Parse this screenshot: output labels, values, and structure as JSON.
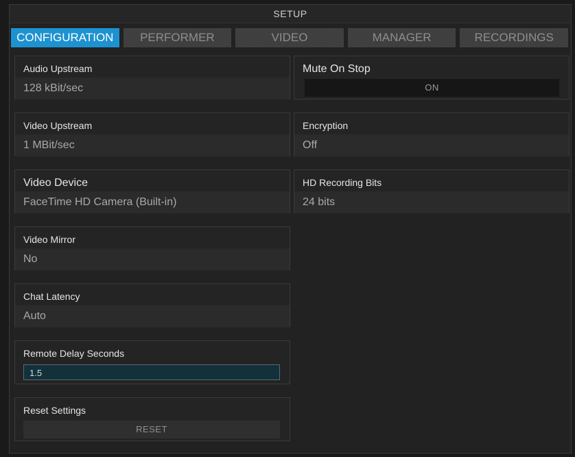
{
  "window": {
    "title": "SETUP"
  },
  "tabs": [
    {
      "label": "CONFIGURATION",
      "active": true
    },
    {
      "label": "PERFORMER",
      "active": false
    },
    {
      "label": "VIDEO",
      "active": false
    },
    {
      "label": "MANAGER",
      "active": false
    },
    {
      "label": "RECORDINGS",
      "active": false
    }
  ],
  "left_settings": {
    "audio_upstream": {
      "label": "Audio Upstream",
      "value": "128 kBit/sec"
    },
    "video_upstream": {
      "label": "Video Upstream",
      "value": "1 MBit/sec"
    },
    "video_device": {
      "label": "Video Device",
      "value": "FaceTime HD Camera (Built-in)"
    },
    "video_mirror": {
      "label": "Video Mirror",
      "value": "No"
    },
    "chat_latency": {
      "label": "Chat Latency",
      "value": "Auto"
    },
    "remote_delay": {
      "label": "Remote Delay Seconds",
      "value": "1.5"
    },
    "reset_settings": {
      "label": "Reset Settings",
      "button": "RESET"
    }
  },
  "right_settings": {
    "mute_on_stop": {
      "label": "Mute On Stop",
      "button": "ON"
    },
    "encryption": {
      "label": "Encryption",
      "value": "Off"
    },
    "hd_recording_bits": {
      "label": "HD Recording Bits",
      "value": "24 bits"
    }
  },
  "colors": {
    "accent": "#1d92d1",
    "background": "#222222",
    "panel": "#242424",
    "input_bg": "#12313b"
  }
}
